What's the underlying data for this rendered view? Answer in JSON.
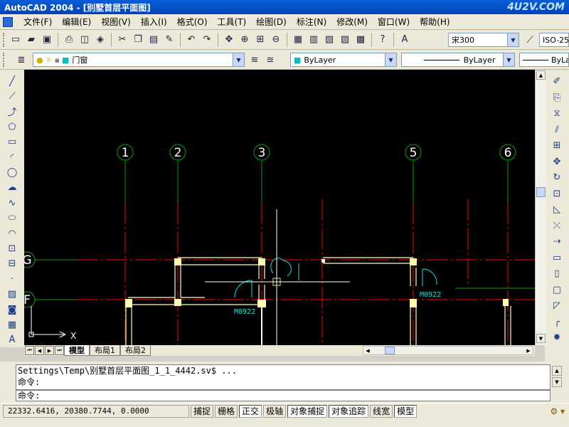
{
  "app": {
    "title": "AutoCAD 2004 - [别墅首层平面图]",
    "watermark": "4U2V.COM"
  },
  "menu": {
    "items": [
      "文件(F)",
      "编辑(E)",
      "视图(V)",
      "插入(I)",
      "格式(O)",
      "工具(T)",
      "绘图(D)",
      "标注(N)",
      "修改(M)",
      "窗口(W)",
      "帮助(H)"
    ]
  },
  "toolbar": {
    "text_style": "宋300",
    "dim_style": "ISO-25",
    "layer": "门窗",
    "color": "ByLayer",
    "linetype": "ByLayer",
    "lineweight": "ByLayer"
  },
  "drawing": {
    "axis_labels": [
      "1",
      "2",
      "3",
      "5",
      "6"
    ],
    "row_labels": [
      "G",
      "F"
    ],
    "door_labels": [
      "M0922",
      "M0922"
    ],
    "ucs_x": "X"
  },
  "layout_tabs": [
    "模型",
    "布局1",
    "布局2"
  ],
  "command": {
    "history": [
      "Settings\\Temp\\别墅首层平面图_1_1_4442.sv$ ...",
      "命令:"
    ],
    "prompt": "命令:"
  },
  "status": {
    "coordinates": "22332.6416, 20380.7744, 0.0000",
    "toggles": [
      {
        "label": "捕捉",
        "on": false
      },
      {
        "label": "栅格",
        "on": false
      },
      {
        "label": "正交",
        "on": true
      },
      {
        "label": "极轴",
        "on": false
      },
      {
        "label": "对象捕捉",
        "on": true
      },
      {
        "label": "对象追踪",
        "on": true
      },
      {
        "label": "线宽",
        "on": false
      },
      {
        "label": "模型",
        "on": true
      }
    ]
  },
  "colors": {
    "canvas": "#000000",
    "axis_line": "#00a000",
    "grid_line": "#d00000",
    "wall": "#ffffb0",
    "door": "#00e0e0",
    "crosshair": "#ffffff"
  }
}
